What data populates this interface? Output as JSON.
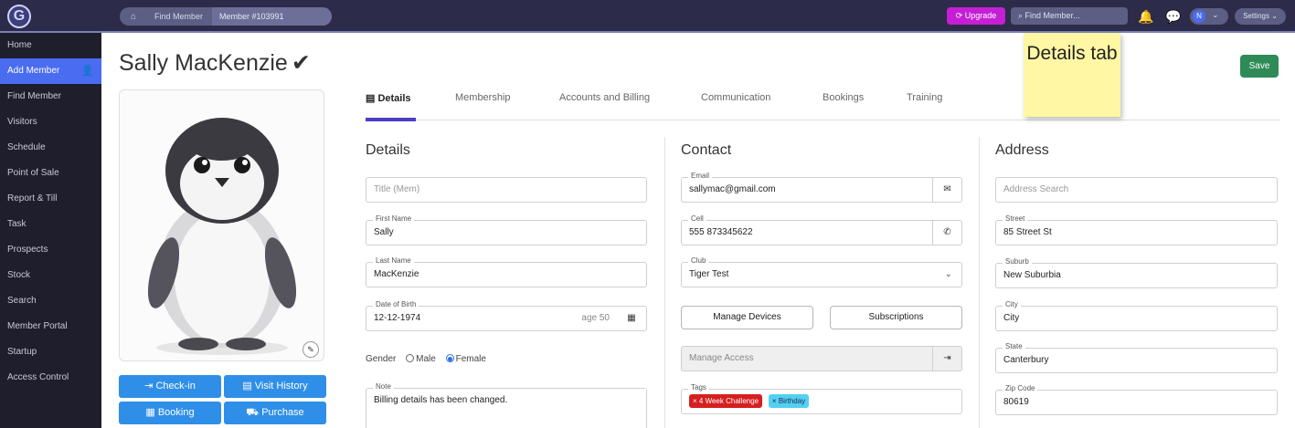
{
  "topbar": {
    "logo": "G",
    "breadcrumb": [
      "Find Member",
      "Member #103991"
    ],
    "upgrade_label": "Upgrade",
    "search_placeholder": "Find Member...",
    "avatar_initial": "N",
    "settings_label": "Settings"
  },
  "sidebar": {
    "items": [
      {
        "label": "Home"
      },
      {
        "label": "Add Member"
      },
      {
        "label": "Find Member"
      },
      {
        "label": "Visitors"
      },
      {
        "label": "Schedule"
      },
      {
        "label": "Point of Sale"
      },
      {
        "label": "Report & Till"
      },
      {
        "label": "Task"
      },
      {
        "label": "Prospects"
      },
      {
        "label": "Stock"
      },
      {
        "label": "Search"
      },
      {
        "label": "Member Portal"
      },
      {
        "label": "Startup"
      },
      {
        "label": "Access Control"
      }
    ]
  },
  "member": {
    "name": "Sally MacKenzie",
    "verified_mark": "✔"
  },
  "actions": {
    "checkin": "Check-in",
    "visit_history": "Visit History",
    "booking": "Booking",
    "purchase": "Purchase"
  },
  "tabs": [
    "Details",
    "Membership",
    "Accounts and Billing",
    "Communication",
    "Bookings",
    "Training"
  ],
  "save_label": "Save",
  "sticky_note": "Details tab",
  "details": {
    "heading": "Details",
    "title_placeholder": "Title (Mem)",
    "first_name_label": "First Name",
    "first_name": "Sally",
    "last_name_label": "Last Name",
    "last_name": "MacKenzie",
    "dob_label": "Date of Birth",
    "dob": "12-12-1974",
    "age": "age 50",
    "gender_label": "Gender",
    "gender_options": [
      "Male",
      "Female"
    ],
    "gender_selected": "Female",
    "note_label": "Note",
    "note": "Billing details has been changed."
  },
  "contact": {
    "heading": "Contact",
    "email_label": "Email",
    "email": "sallymac@gmail.com",
    "cell_label": "Cell",
    "cell": "555 873345622",
    "club_label": "Club",
    "club": "Tiger Test",
    "manage_devices": "Manage Devices",
    "subscriptions": "Subscriptions",
    "manage_access": "Manage Access",
    "tags_label": "Tags",
    "tags": [
      "4 Week Challenge",
      "Birthday"
    ]
  },
  "address": {
    "heading": "Address",
    "search_placeholder": "Address Search",
    "street_label": "Street",
    "street": "85 Street St",
    "suburb_label": "Suburb",
    "suburb": "New Suburbia",
    "city_label": "City",
    "city": "City",
    "state_label": "State",
    "state": "Canterbury",
    "zip_label": "Zip Code",
    "zip": "80619"
  }
}
